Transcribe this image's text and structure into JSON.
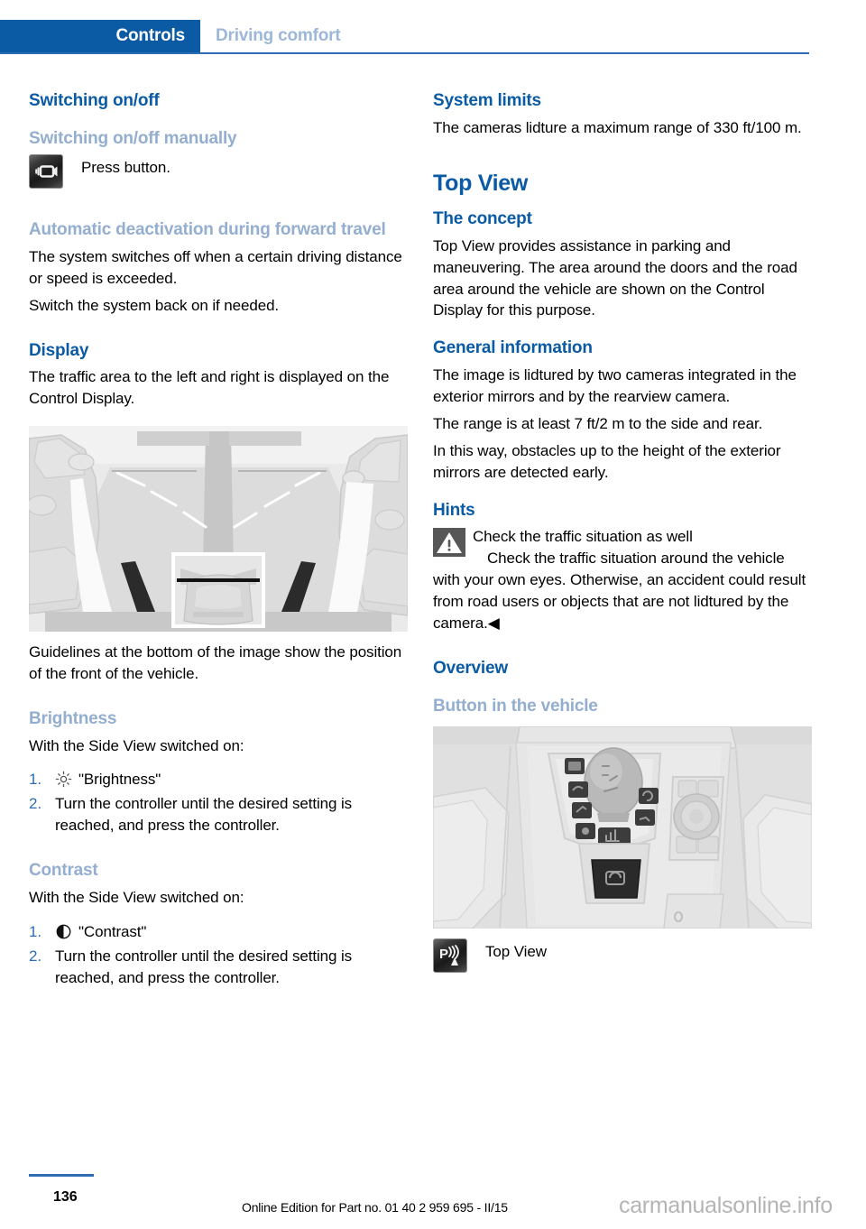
{
  "header": {
    "active_tab": "Controls",
    "inactive_tab": "Driving comfort",
    "accent_color": "#0a5aa4",
    "muted_color": "#94aed0"
  },
  "left_column": {
    "heading_switching": "Switching on/off",
    "sub_manually": "Switching on/off manually",
    "press_button_text": "Press button.",
    "press_button_icon": "side-view-camera-button-icon",
    "sub_auto_deactivation": "Automatic deactivation during forward travel",
    "para_auto_1": "The system switches off when a certain driving distance or speed is exceeded.",
    "para_auto_2": "Switch the system back on if needed.",
    "heading_display": "Display",
    "para_display": "The traffic area to the left and right is displayed on the Control Display.",
    "figure_sideview_caption": "side-view-camera-display-illustration",
    "para_guidelines": "Guidelines at the bottom of the image show the position of the front of the vehicle.",
    "sub_brightness": "Brightness",
    "brightness_intro": "With the Side View switched on:",
    "brightness_steps": [
      {
        "num": "1.",
        "icon": "sun-icon",
        "text": "\"Brightness\""
      },
      {
        "num": "2.",
        "icon": "",
        "text": "Turn the controller until the desired setting is reached, and press the controller."
      }
    ],
    "sub_contrast": "Contrast",
    "contrast_intro": "With the Side View switched on:",
    "contrast_steps": [
      {
        "num": "1.",
        "icon": "contrast-circle-icon",
        "text": "\"Contrast\""
      },
      {
        "num": "2.",
        "icon": "",
        "text": "Turn the controller until the desired setting is reached, and press the controller."
      }
    ]
  },
  "right_column": {
    "heading_system_limits": "System limits",
    "para_system_limits": "The cameras lidture a maximum range of 330 ft/100 m.",
    "chapter_top_view": "Top View",
    "heading_concept": "The concept",
    "para_concept": "Top View provides assistance in parking and maneuvering. The area around the doors and the road area around the vehicle are shown on the Control Display for this purpose.",
    "heading_general_info": "General information",
    "para_general_1": "The image is lidtured by two cameras integrated in the exterior mirrors and by the rearview camera.",
    "para_general_2": "The range is at least 7 ft/2 m to the side and rear.",
    "para_general_3": "In this way, obstacles up to the height of the exterior mirrors are detected early.",
    "heading_hints": "Hints",
    "hint_icon": "warning-triangle-icon",
    "hint_title": "Check the traffic situation as well",
    "hint_body": "Check the traffic situation around the vehicle with your own eyes. Otherwise, an accident could result from road users or objects that are not lidtured by the camera.◀",
    "heading_overview": "Overview",
    "sub_button_in_vehicle": "Button in the vehicle",
    "figure_console_caption": "center-console-illustration",
    "top_view_button_icon": "top-view-parking-button-icon",
    "top_view_button_label": "Top View"
  },
  "footer": {
    "page_number": "136",
    "edition": "Online Edition for Part no. 01 40 2 959 695 - II/15",
    "watermark": "carmanualsonline.info"
  }
}
